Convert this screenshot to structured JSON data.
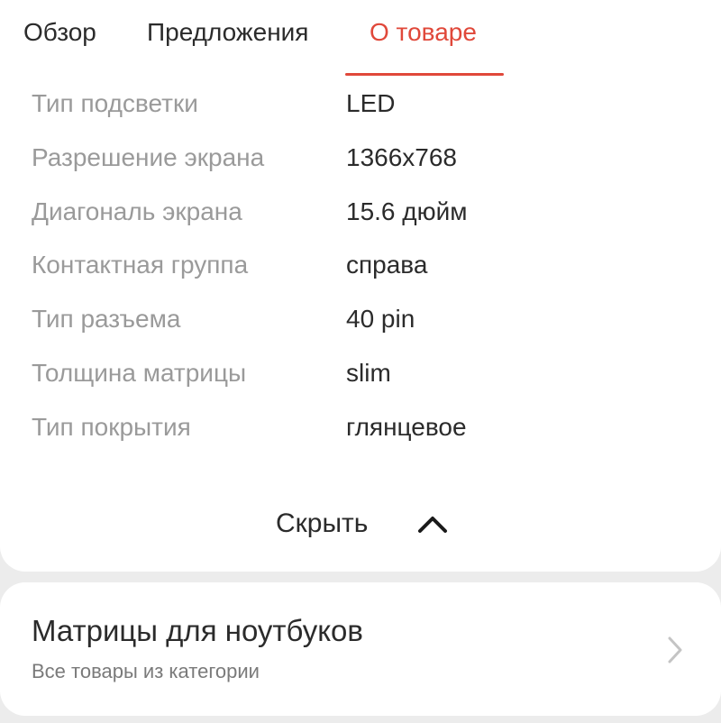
{
  "tabs": [
    {
      "label": "Обзор",
      "active": false
    },
    {
      "label": "Предложения",
      "active": false
    },
    {
      "label": "О товаре",
      "active": true
    }
  ],
  "specs": [
    {
      "label": "Тип подсветки",
      "value": "LED"
    },
    {
      "label": "Разрешение экрана",
      "value": "1366x768"
    },
    {
      "label": "Диагональ экрана",
      "value": "15.6 дюйм"
    },
    {
      "label": "Контактная группа",
      "value": "справа"
    },
    {
      "label": "Тип разъема",
      "value": "40 pin"
    },
    {
      "label": "Толщина матрицы",
      "value": "slim"
    },
    {
      "label": "Тип покрытия",
      "value": "глянцевое"
    }
  ],
  "collapse": {
    "label": "Скрыть",
    "icon": "chevron-up-icon"
  },
  "category": {
    "title": "Матрицы для ноутбуков",
    "subtitle": "Все товары из категории",
    "icon": "chevron-right-icon"
  },
  "colors": {
    "accent": "#e0483a",
    "text_primary": "#2b2b2b",
    "text_secondary": "#9a9a9a",
    "background": "#ececec",
    "card": "#ffffff"
  }
}
